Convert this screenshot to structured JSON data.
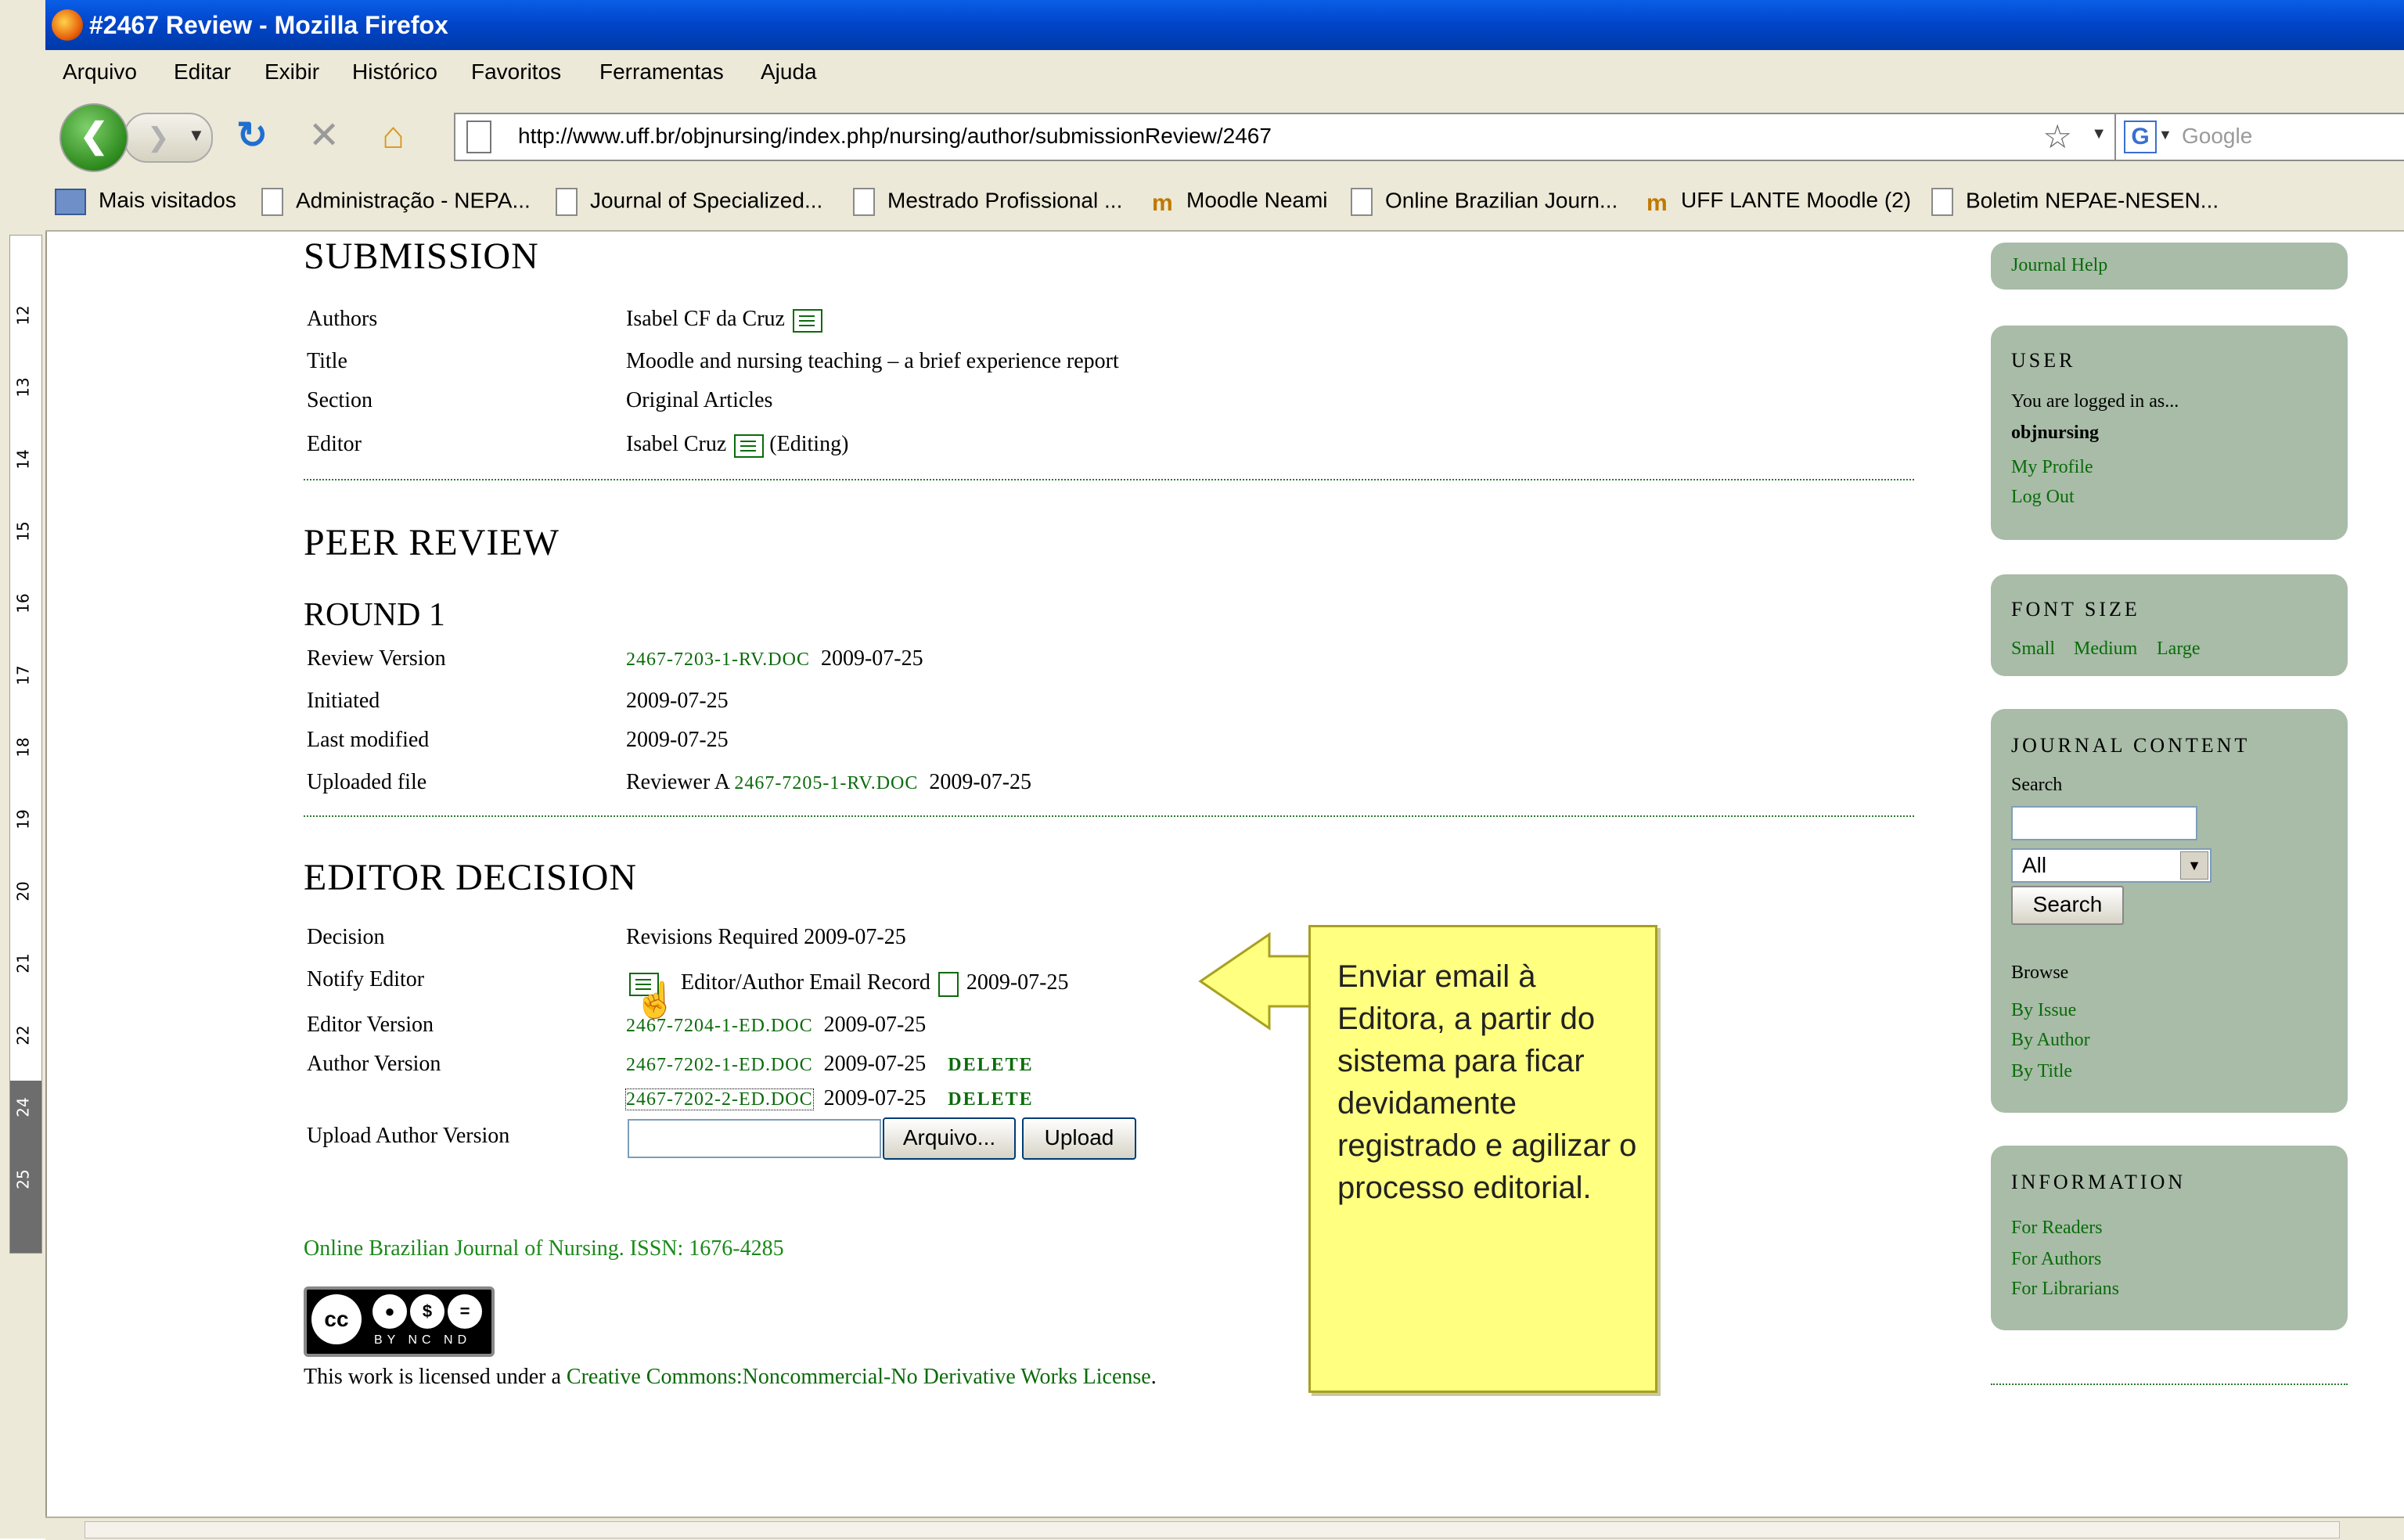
{
  "window": {
    "title": "#2467 Review - Mozilla Firefox"
  },
  "menu": [
    "Arquivo",
    "Editar",
    "Exibir",
    "Histórico",
    "Favoritos",
    "Ferramentas",
    "Ajuda"
  ],
  "address": {
    "url": "http://www.uff.br/objnursing/index.php/nursing/author/submissionReview/2467"
  },
  "search_engine": {
    "placeholder": "Google"
  },
  "bookmarks": [
    {
      "label": "Mais visitados",
      "icon": "bookmarks-folder-icon"
    },
    {
      "label": "Administração - NEPA...",
      "icon": "page-icon"
    },
    {
      "label": "Journal of Specialized...",
      "icon": "page-icon"
    },
    {
      "label": "Mestrado Profissional ...",
      "icon": "page-icon"
    },
    {
      "label": "Moodle Neami",
      "icon": "moodle-icon"
    },
    {
      "label": "Online Brazilian Journ...",
      "icon": "page-icon"
    },
    {
      "label": "UFF LANTE Moodle (2)",
      "icon": "moodle-icon"
    },
    {
      "label": "Boletim NEPAE-NESEN...",
      "icon": "page-icon"
    }
  ],
  "submission": {
    "heading": "SUBMISSION",
    "authors_label": "Authors",
    "authors_value": "Isabel CF da Cruz",
    "title_label": "Title",
    "title_value": "Moodle and nursing teaching – a brief experience report",
    "section_label": "Section",
    "section_value": "Original Articles",
    "editor_label": "Editor",
    "editor_value": "Isabel Cruz",
    "editor_suffix": "(Editing)"
  },
  "peer_review": {
    "heading": "PEER REVIEW",
    "round": "ROUND 1",
    "review_version_label": "Review Version",
    "review_version_file": "2467-7203-1-RV.DOC",
    "review_version_date": "2009-07-25",
    "initiated_label": "Initiated",
    "initiated_value": "2009-07-25",
    "last_modified_label": "Last modified",
    "last_modified_value": "2009-07-25",
    "uploaded_label": "Uploaded file",
    "uploaded_reviewer": "Reviewer A",
    "uploaded_file": "2467-7205-1-RV.DOC",
    "uploaded_date": "2009-07-25"
  },
  "editor_decision": {
    "heading": "EDITOR DECISION",
    "decision_label": "Decision",
    "decision_value": "Revisions Required 2009-07-25",
    "notify_label": "Notify Editor",
    "notify_record": "Editor/Author Email Record",
    "notify_date": "2009-07-25",
    "editor_version_label": "Editor Version",
    "editor_version_file": "2467-7204-1-ED.DOC",
    "editor_version_date": "2009-07-25",
    "author_version_label": "Author Version",
    "author_versions": [
      {
        "file": "2467-7202-1-ED.DOC",
        "date": "2009-07-25",
        "action": "DELETE"
      },
      {
        "file": "2467-7202-2-ED.DOC",
        "date": "2009-07-25",
        "action": "DELETE"
      }
    ],
    "upload_label": "Upload Author Version",
    "browse_button": "Arquivo...",
    "upload_button": "Upload"
  },
  "footer": {
    "journal": "Online Brazilian Journal of Nursing. ISSN: 1676-4285",
    "cc_caption": "BY NC ND",
    "license_prefix": "This work is licensed under a",
    "license_link": "Creative Commons:Noncommercial-No Derivative Works License",
    "license_suffix": "."
  },
  "callout": {
    "text": "Enviar email à Editora, a partir do sistema para ficar devidamente registrado e agilizar o processo editorial."
  },
  "sidebar": {
    "journal_help": "Journal Help",
    "user_title": "USER",
    "user_logged": "You are logged in as...",
    "user_name": "objnursing",
    "my_profile": "My Profile",
    "log_out": "Log Out",
    "font_title": "FONT SIZE",
    "font_small": "Small",
    "font_medium": "Medium",
    "font_large": "Large",
    "content_title": "JOURNAL CONTENT",
    "search_label": "Search",
    "search_scope": "All",
    "search_button": "Search",
    "browse_label": "Browse",
    "by_issue": "By Issue",
    "by_author": "By Author",
    "by_title": "By Title",
    "info_title": "INFORMATION",
    "for_readers": "For Readers",
    "for_authors": "For Authors",
    "for_librarians": "For Librarians"
  },
  "ruler_numbers": [
    "12",
    "13",
    "14",
    "15",
    "16",
    "17",
    "18",
    "19",
    "20",
    "21",
    "22",
    "24",
    "25"
  ],
  "colors": {
    "link": "#0a6b0a",
    "sidebar_block": "#a8bca8",
    "callout": "#ffff80",
    "titlebar": "#0a5ee6"
  }
}
